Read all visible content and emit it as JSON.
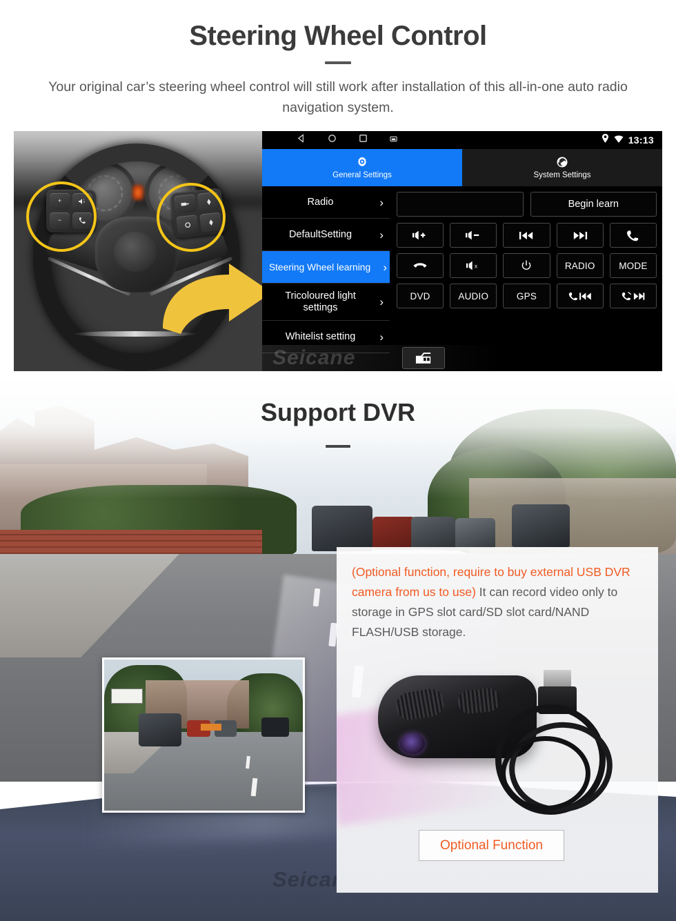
{
  "section1": {
    "title": "Steering Wheel Control",
    "subtitle": "Your original car’s steering wheel control will still work after installation of this all-in-one auto radio navigation system.",
    "head_unit": {
      "statusbar": {
        "nav_icons": [
          "back-icon",
          "home-icon",
          "recents-icon",
          "screenshot-icon"
        ],
        "location_icon": "location-pin-icon",
        "wifi_icon": "wifi-icon",
        "time": "13:13"
      },
      "tabs": [
        {
          "label": "General Settings",
          "icon": "gear-icon",
          "active": true
        },
        {
          "label": "System Settings",
          "icon": "system-logo-icon",
          "active": false
        }
      ],
      "menu": [
        {
          "label": "Radio",
          "active": false
        },
        {
          "label": "DefaultSetting",
          "active": false
        },
        {
          "label": "Steering Wheel learning",
          "active": true
        },
        {
          "label": "Tricoloured light settings",
          "active": false
        },
        {
          "label": "Whitelist setting",
          "active": false
        }
      ],
      "panel": {
        "input_value": "",
        "begin_learn_label": "Begin learn",
        "buttons": [
          {
            "label": "",
            "icon": "volume-up-icon"
          },
          {
            "label": "",
            "icon": "volume-down-icon"
          },
          {
            "label": "",
            "icon": "previous-track-icon"
          },
          {
            "label": "",
            "icon": "next-track-icon"
          },
          {
            "label": "",
            "icon": "phone-answer-icon"
          },
          {
            "label": "",
            "icon": "phone-hangup-icon"
          },
          {
            "label": "",
            "icon": "mute-icon"
          },
          {
            "label": "",
            "icon": "power-icon"
          },
          {
            "label": "RADIO",
            "icon": ""
          },
          {
            "label": "MODE",
            "icon": ""
          },
          {
            "label": "DVD",
            "icon": ""
          },
          {
            "label": "AUDIO",
            "icon": ""
          },
          {
            "label": "GPS",
            "icon": ""
          },
          {
            "label": "",
            "icon": "phone-previous-icon"
          },
          {
            "label": "",
            "icon": "phone-reject-next-icon"
          }
        ]
      },
      "dock": {
        "icon": "car-front-icon"
      },
      "watermark": "Seicane"
    }
  },
  "section2": {
    "title": "Support DVR",
    "card": {
      "highlight_text": "(Optional function, require to buy external USB DVR camera from us to use)",
      "body_text": "It can record video only to storage in GPS slot card/SD slot card/NAND FLASH/USB storage.",
      "button_label": "Optional Function",
      "highlight_color": "#f15a22",
      "body_color": "#5a5a5a"
    },
    "watermark": "Seicane"
  },
  "theme": {
    "accent_blue": "#1279f7",
    "accent_orange": "#f15a22",
    "highlight_yellow": "#f5c518",
    "heading_color": "#3b3b3b"
  }
}
